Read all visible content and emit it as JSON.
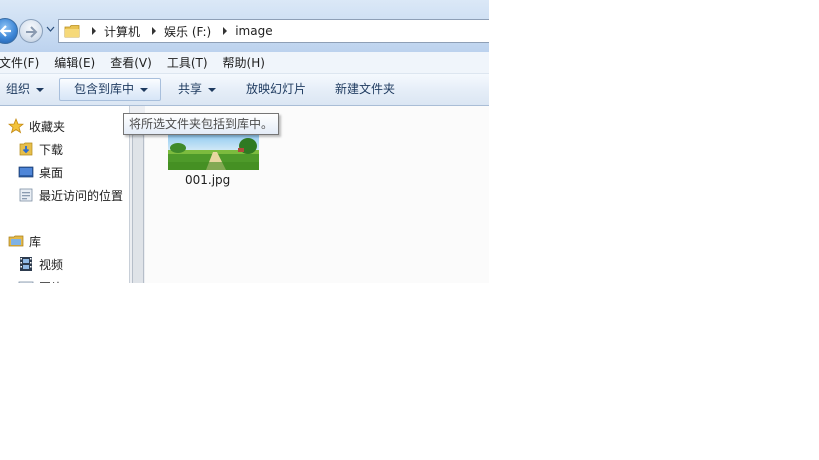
{
  "address": {
    "crumbs": [
      "计算机",
      "娱乐 (F:)",
      "image"
    ]
  },
  "menu": [
    "文件(F)",
    "编辑(E)",
    "查看(V)",
    "工具(T)",
    "帮助(H)"
  ],
  "toolbar": {
    "organize": "组织",
    "include": "包含到库中",
    "share": "共享",
    "slideshow": "放映幻灯片",
    "new_folder": "新建文件夹"
  },
  "tooltip": "将所选文件夹包括到库中。",
  "nav": {
    "favorites": "收藏夹",
    "downloads": "下载",
    "desktop": "桌面",
    "recent": "最近访问的位置",
    "libraries": "库",
    "videos": "视频",
    "pictures": "图片"
  },
  "files": [
    {
      "name": "001.jpg"
    }
  ],
  "colors": {
    "accent": "#3d86d6",
    "toolbar_text": "#1e3a5f"
  }
}
